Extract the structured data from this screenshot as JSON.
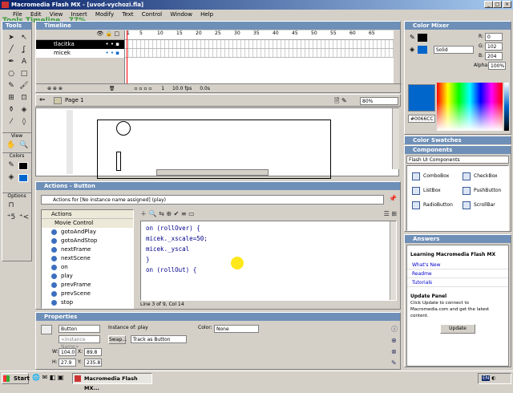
{
  "window": {
    "title": "Macromedia Flash MX - [uvod-vychozi.fla]",
    "min": "_",
    "max": "□",
    "close": "×"
  },
  "menu": [
    "File",
    "Edit",
    "View",
    "Insert",
    "Modify",
    "Text",
    "Control",
    "Window",
    "Help"
  ],
  "watermark": "Tools Timeline...77%",
  "tools": {
    "header": "Tools",
    "view_label": "View",
    "colors_label": "Colors",
    "options_label": "Options"
  },
  "timeline": {
    "header": "Timeline",
    "layers": [
      "tlacitka",
      "micek"
    ],
    "frames": [
      "1",
      "5",
      "10",
      "15",
      "20",
      "25",
      "30",
      "35",
      "40",
      "45",
      "50",
      "55",
      "60",
      "65"
    ],
    "current_frame": "1",
    "fps": "10.0 fps",
    "time": "0.0s"
  },
  "stage": {
    "scene": "Page 1",
    "zoom": "80%"
  },
  "actions": {
    "header": "Actions - Button",
    "target": "Actions for [No instance name assigned] (play)",
    "tree": {
      "root": "Actions",
      "group": "Movie Control",
      "items": [
        "gotoAndPlay",
        "gotoAndStop",
        "nextFrame",
        "nextScene",
        "on",
        "play",
        "prevFrame",
        "prevScene",
        "stop"
      ]
    },
    "code": [
      "on (rollOver) {",
      "micek._xscale=50;",
      "micek._yscal",
      "}",
      "on (rollOut) {"
    ],
    "status": "Line 3 of 9, Col 14"
  },
  "properties": {
    "header": "Properties",
    "type": "Button",
    "instance_name": "<Instance Name>",
    "instance_of_label": "Instance of:",
    "instance_of": "play",
    "swap": "Swap...",
    "track": "Track as Button",
    "color_label": "Color:",
    "color_value": "None",
    "w_label": "W:",
    "w": "104.0",
    "x_label": "X:",
    "x": "89.8",
    "h_label": "H:",
    "h": "27.9",
    "y_label": "Y:",
    "y": "235.8"
  },
  "color_mixer": {
    "header": "Color Mixer",
    "r_label": "R:",
    "r": "0",
    "g_label": "G:",
    "g": "102",
    "b_label": "B:",
    "b": "204",
    "alpha_label": "Alpha:",
    "alpha": "100%",
    "fill_type": "Solid",
    "hex": "#0066CC",
    "swatch": "#0066cc"
  },
  "swatches": {
    "header": "Color Swatches"
  },
  "components": {
    "header": "Components",
    "set": "Flash UI Components",
    "items": [
      "ComboBox",
      "CheckBox",
      "ListBox",
      "PushButton",
      "RadioButton",
      "ScrollBar"
    ]
  },
  "answers": {
    "header": "Answers",
    "title": "Learning Macromedia Flash MX",
    "links": [
      "What's New",
      "Readme",
      "Tutorials"
    ],
    "update_title": "Update Panel",
    "update_text": "Click Update to connect to Macromedia.com and get the latest content.",
    "update_button": "Update"
  },
  "taskbar": {
    "start": "Start",
    "task": "Macromedia Flash MX...",
    "lang": "EN",
    "time": ""
  }
}
